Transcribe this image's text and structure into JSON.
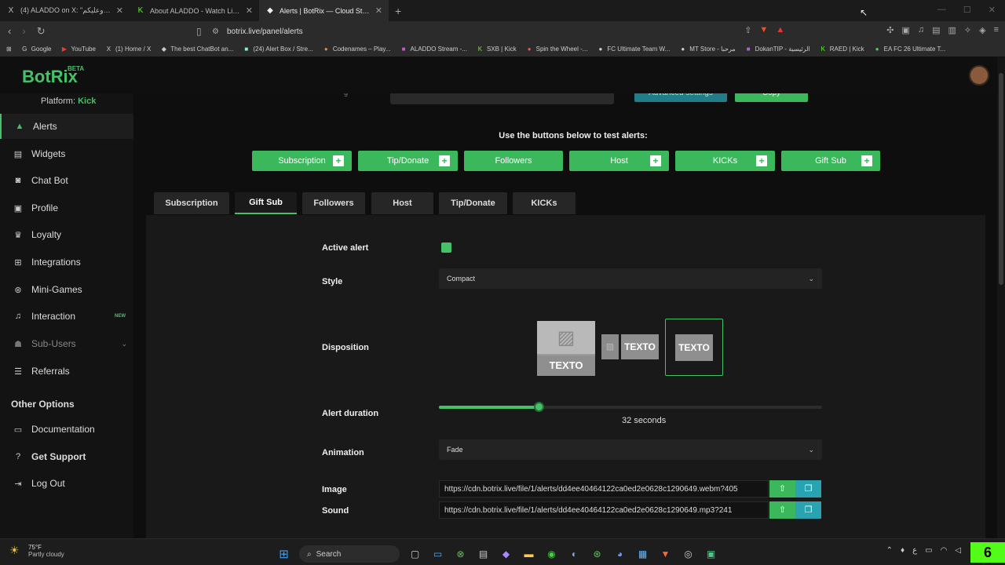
{
  "browser": {
    "tabs": [
      {
        "icon": "X",
        "title": "(4) ALADDO on X: \"سبارك علينا وعليكم"
      },
      {
        "icon": "K",
        "title": "About ALADDO - Watch Live on Kick"
      },
      {
        "icon": "◆",
        "title": "Alerts | BotRix — Cloud Streaming"
      }
    ],
    "new_tab": "+",
    "url": "botrix.live/panel/alerts",
    "bookmarks": [
      {
        "icon": "G",
        "label": "Google"
      },
      {
        "icon": "▶",
        "label": "YouTube"
      },
      {
        "icon": "X",
        "label": "(1) Home / X"
      },
      {
        "icon": "◆",
        "label": "The best ChatBot an..."
      },
      {
        "icon": "■",
        "label": "(24) Alert Box / Stre..."
      },
      {
        "icon": "●",
        "label": "Codenames – Play..."
      },
      {
        "icon": "■",
        "label": "ALADDO Stream -..."
      },
      {
        "icon": "K",
        "label": "SXB | Kick"
      },
      {
        "icon": "●",
        "label": "Spin the Wheel -..."
      },
      {
        "icon": "●",
        "label": "FC Ultimate Team W..."
      },
      {
        "icon": "●",
        "label": "MT Store - مرحبا"
      },
      {
        "icon": "■",
        "label": "DokanTIP - الرئيسية"
      },
      {
        "icon": "K",
        "label": "RAED | Kick"
      },
      {
        "icon": "●",
        "label": "EA FC 26 Ultimate T..."
      }
    ]
  },
  "header": {
    "logo": "BotRix",
    "badge": "BETA"
  },
  "sidebar": {
    "platform_label": "Platform:",
    "platform_value": "Kick",
    "items": [
      {
        "label": "Alerts",
        "icon": "warning-icon"
      },
      {
        "label": "Widgets",
        "icon": "widgets-icon"
      },
      {
        "label": "Chat Bot",
        "icon": "robot-icon"
      },
      {
        "label": "Profile",
        "icon": "profile-icon"
      },
      {
        "label": "Loyalty",
        "icon": "trophy-icon"
      },
      {
        "label": "Integrations",
        "icon": "integrations-icon"
      },
      {
        "label": "Mini-Games",
        "icon": "gamepad-icon"
      },
      {
        "label": "Interaction",
        "icon": "music-icon",
        "badge": "NEW"
      },
      {
        "label": "Sub-Users",
        "icon": "users-icon"
      },
      {
        "label": "Referrals",
        "icon": "referrals-icon"
      }
    ],
    "other_title": "Other Options",
    "other_items": [
      {
        "label": "Documentation",
        "icon": "book-icon"
      },
      {
        "label": "Get Support",
        "icon": "help-icon"
      },
      {
        "label": "Log Out",
        "icon": "logout-icon"
      }
    ]
  },
  "main": {
    "advanced_label": "Advanced settings",
    "copy_label": "Copy",
    "test_label": "Use the buttons below to test alerts:",
    "test_buttons": [
      "Subscription",
      "Tip/Donate",
      "Followers",
      "Host",
      "KICKs",
      "Gift Sub"
    ],
    "tabs": [
      "Subscription",
      "Gift Sub",
      "Followers",
      "Host",
      "Tip/Donate",
      "KICKs"
    ],
    "selected_tab": "Gift Sub",
    "form": {
      "active_label": "Active alert",
      "active": true,
      "style_label": "Style",
      "style_value": "Compact",
      "disposition_label": "Disposition",
      "disposition_text": "TEXTO",
      "disposition_selected": 3,
      "duration_label": "Alert duration",
      "duration_value": "32",
      "duration_unit": "seconds",
      "duration_fraction": 0.26,
      "animation_label": "Animation",
      "animation_value": "Fade",
      "image_label": "Image",
      "image_url": "https://cdn.botrix.live/file/1/alerts/dd4ee40464122ca0ed2e0628c1290649.webm?405",
      "sound_label": "Sound",
      "sound_url": "https://cdn.botrix.live/file/1/alerts/dd4ee40464122ca0ed2e0628c1290649.mp3?241"
    }
  },
  "taskbar": {
    "temp": "75°F",
    "weather": "Partly cloudy",
    "search": "Search",
    "kick_count": "6"
  }
}
